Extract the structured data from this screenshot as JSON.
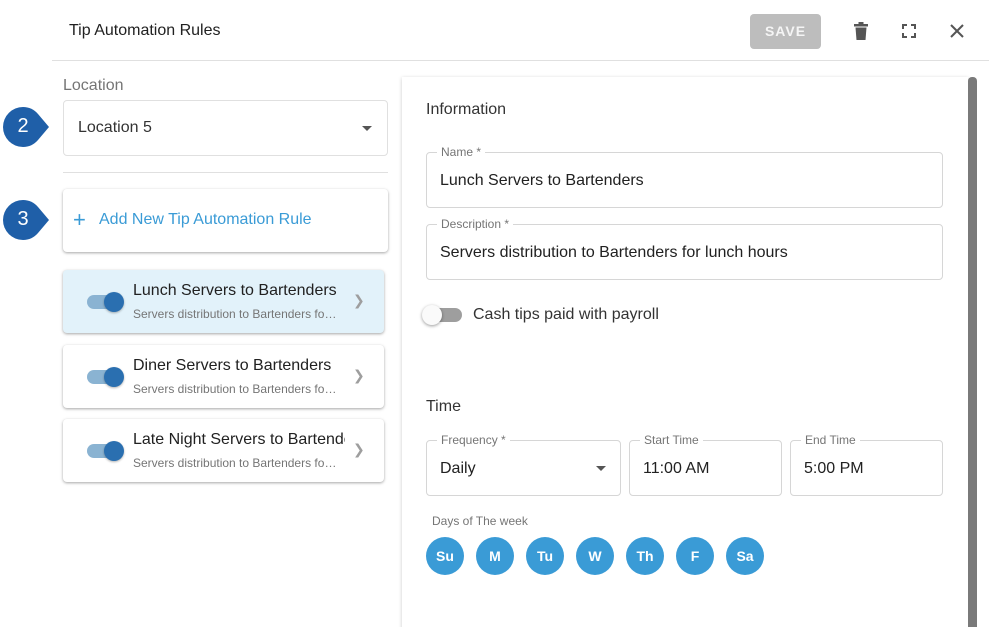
{
  "header": {
    "title": "Tip Automation Rules",
    "save_label": "SAVE",
    "icons": [
      "trash-icon",
      "fullscreen-icon",
      "close-icon"
    ]
  },
  "location": {
    "label": "Location",
    "value": "Location 5"
  },
  "badges": [
    "2",
    "3"
  ],
  "add_rule": {
    "plus": "+",
    "label": "Add New Tip Automation Rule"
  },
  "rules": [
    {
      "name": "Lunch Servers to Bartenders",
      "description": "Servers distribution to Bartenders for lunch hours",
      "enabled": true,
      "selected": true
    },
    {
      "name": "Diner Servers to Bartenders",
      "description": "Servers distribution to Bartenders for dinner hours",
      "enabled": true,
      "selected": false
    },
    {
      "name": "Late Night Servers to Bartenders",
      "description": "Servers distribution to Bartenders for late night hours",
      "enabled": true,
      "selected": false
    }
  ],
  "information": {
    "heading": "Information",
    "name_label": "Name *",
    "name_value": "Lunch Servers to Bartenders",
    "description_label": "Description *",
    "description_value": "Servers distribution to Bartenders for lunch hours",
    "cash_tips_label": "Cash tips paid with payroll",
    "cash_tips_enabled": false
  },
  "time": {
    "heading": "Time",
    "frequency_label": "Frequency *",
    "frequency_value": "Daily",
    "start_label": "Start Time",
    "start_value": "11:00 AM",
    "end_label": "End Time",
    "end_value": "5:00 PM",
    "days_label": "Days of The week",
    "days": [
      "Su",
      "M",
      "Tu",
      "W",
      "Th",
      "F",
      "Sa"
    ]
  },
  "colors": {
    "accent": "#3a9bd6",
    "badge": "#1f5fa8",
    "selected_row": "#e2f2fa",
    "toggle_on": "#2a6fb0"
  }
}
